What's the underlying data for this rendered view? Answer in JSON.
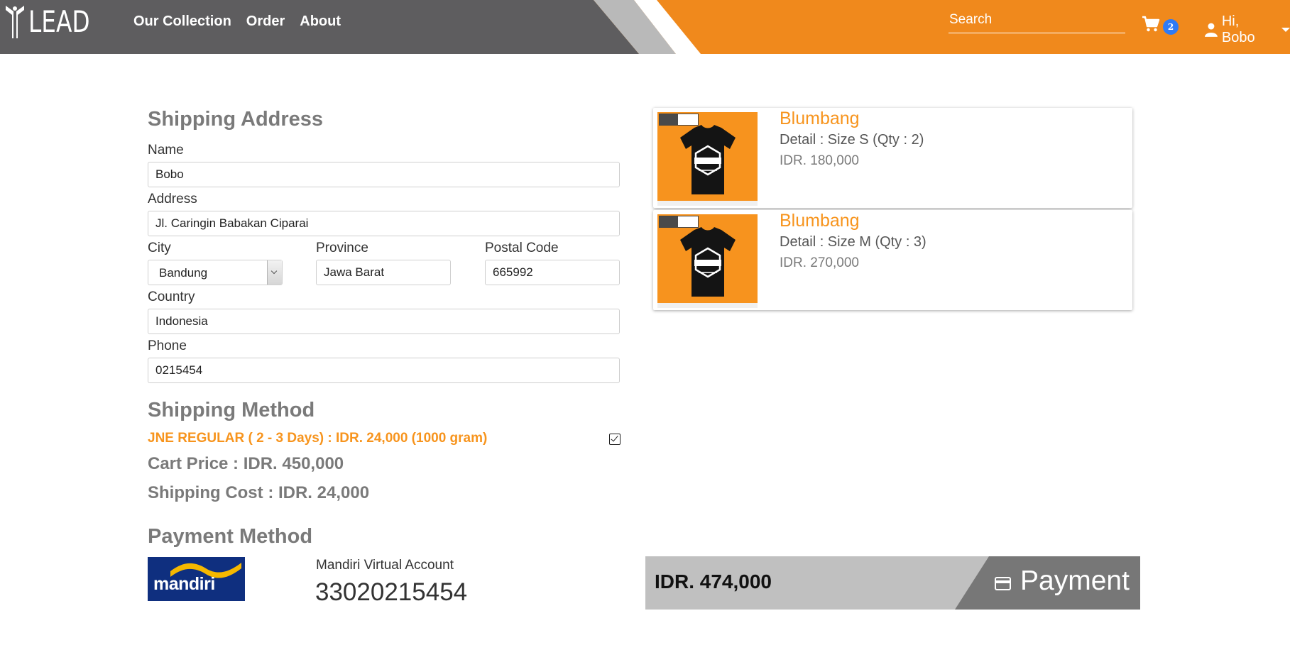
{
  "header": {
    "logo_text": "LEAD",
    "nav": [
      "Our Collection",
      "Order",
      "About"
    ],
    "search_placeholder": "Search",
    "cart_count": "2",
    "user_greeting": "Hi, Bobo"
  },
  "shipping_address": {
    "title": "Shipping Address",
    "name_label": "Name",
    "name_value": "Bobo",
    "address_label": "Address",
    "address_value": "Jl. Caringin Babakan Ciparai",
    "city_label": "City",
    "city_value": "Bandung",
    "province_label": "Province",
    "province_value": "Jawa Barat",
    "postal_label": "Postal Code",
    "postal_value": "665992",
    "country_label": "Country",
    "country_value": "Indonesia",
    "phone_label": "Phone",
    "phone_value": "0215454"
  },
  "shipping_method": {
    "title": "Shipping Method",
    "option": "JNE REGULAR ( 2 - 3 Days) : IDR. 24,000 (1000 gram)",
    "selected": true,
    "cart_price": "Cart Price : IDR. 450,000",
    "shipping_cost": "Shipping Cost : IDR. 24,000"
  },
  "payment_method": {
    "title": "Payment Method",
    "bank": "mandiri",
    "va_label": "Mandiri Virtual Account",
    "va_number": "33020215454"
  },
  "cart_items": [
    {
      "name": "Blumbang",
      "detail": "Detail : Size S (Qty : 2)",
      "price": "IDR. 180,000"
    },
    {
      "name": "Blumbang",
      "detail": "Detail : Size M (Qty : 3)",
      "price": "IDR. 270,000"
    }
  ],
  "payment": {
    "total": "IDR. 474,000",
    "button_label": "Payment"
  },
  "colors": {
    "header_gray": "#5e5d5f",
    "header_orange": "#f0891c",
    "accent_orange": "#f7941d",
    "badge_blue": "#2f7bf5",
    "paybar_gray": "#c0c0c0",
    "paybutton_gray": "#777777",
    "mandiri_blue": "#0f2f7f",
    "mandiri_yellow": "#f6b800"
  },
  "icons": [
    "lead-logo-icon",
    "cart-icon",
    "user-icon",
    "chevron-down-icon",
    "checkbox-checked-icon",
    "credit-card-icon",
    "mandiri-logo"
  ]
}
